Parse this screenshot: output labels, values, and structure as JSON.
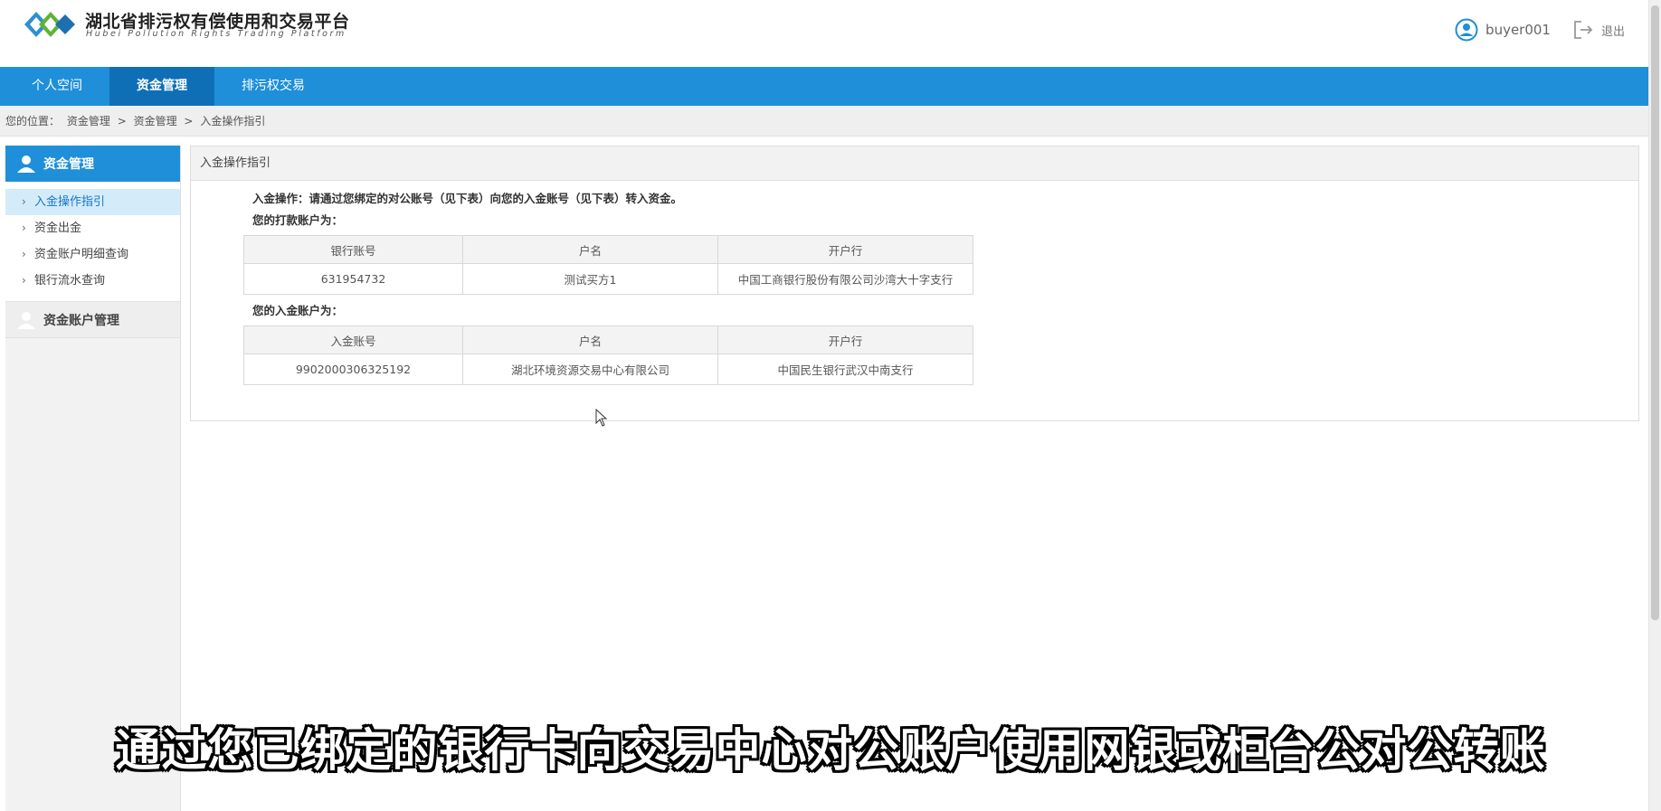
{
  "header": {
    "title": "湖北省排污权有偿使用和交易平台",
    "subtitle": "Hubei Pollution Rights Trading Platform",
    "username": "buyer001",
    "logout_label": "退出"
  },
  "nav": {
    "items": [
      {
        "label": "个人空间"
      },
      {
        "label": "资金管理"
      },
      {
        "label": "排污权交易"
      }
    ]
  },
  "breadcrumb": {
    "prefix": "您的位置：",
    "path": [
      "资金管理",
      ">",
      "资金管理",
      ">",
      "入金操作指引"
    ]
  },
  "sidebar": {
    "section1": "资金管理",
    "items": [
      {
        "label": "入金操作指引"
      },
      {
        "label": "资金出金"
      },
      {
        "label": "资金账户明细查询"
      },
      {
        "label": "银行流水查询"
      }
    ],
    "section2": "资金账户管理"
  },
  "panel": {
    "title": "入金操作指引",
    "instruction": "入金操作：请通过您绑定的对公账号（见下表）向您的入金账号（见下表）转入资金。",
    "pay_account_title": "您的打款账户为：",
    "pay_table": {
      "headers": [
        "银行账号",
        "户名",
        "开户行"
      ],
      "row": [
        "631954732",
        "测试买方1",
        "中国工商银行股份有限公司沙湾大十字支行"
      ]
    },
    "deposit_account_title": "您的入金账户为：",
    "deposit_table": {
      "headers": [
        "入金账号",
        "户名",
        "开户行"
      ],
      "row": [
        "9902000306325192",
        "湖北环境资源交易中心有限公司",
        "中国民生银行武汉中南支行"
      ]
    }
  },
  "caption": "通过您已绑定的银行卡向交易中心对公账户使用网银或柜台公对公转账",
  "colors": {
    "nav_bg": "#1e8fd8",
    "nav_active": "#0f6fb6",
    "sidebar_active": "#d4ebfa"
  }
}
